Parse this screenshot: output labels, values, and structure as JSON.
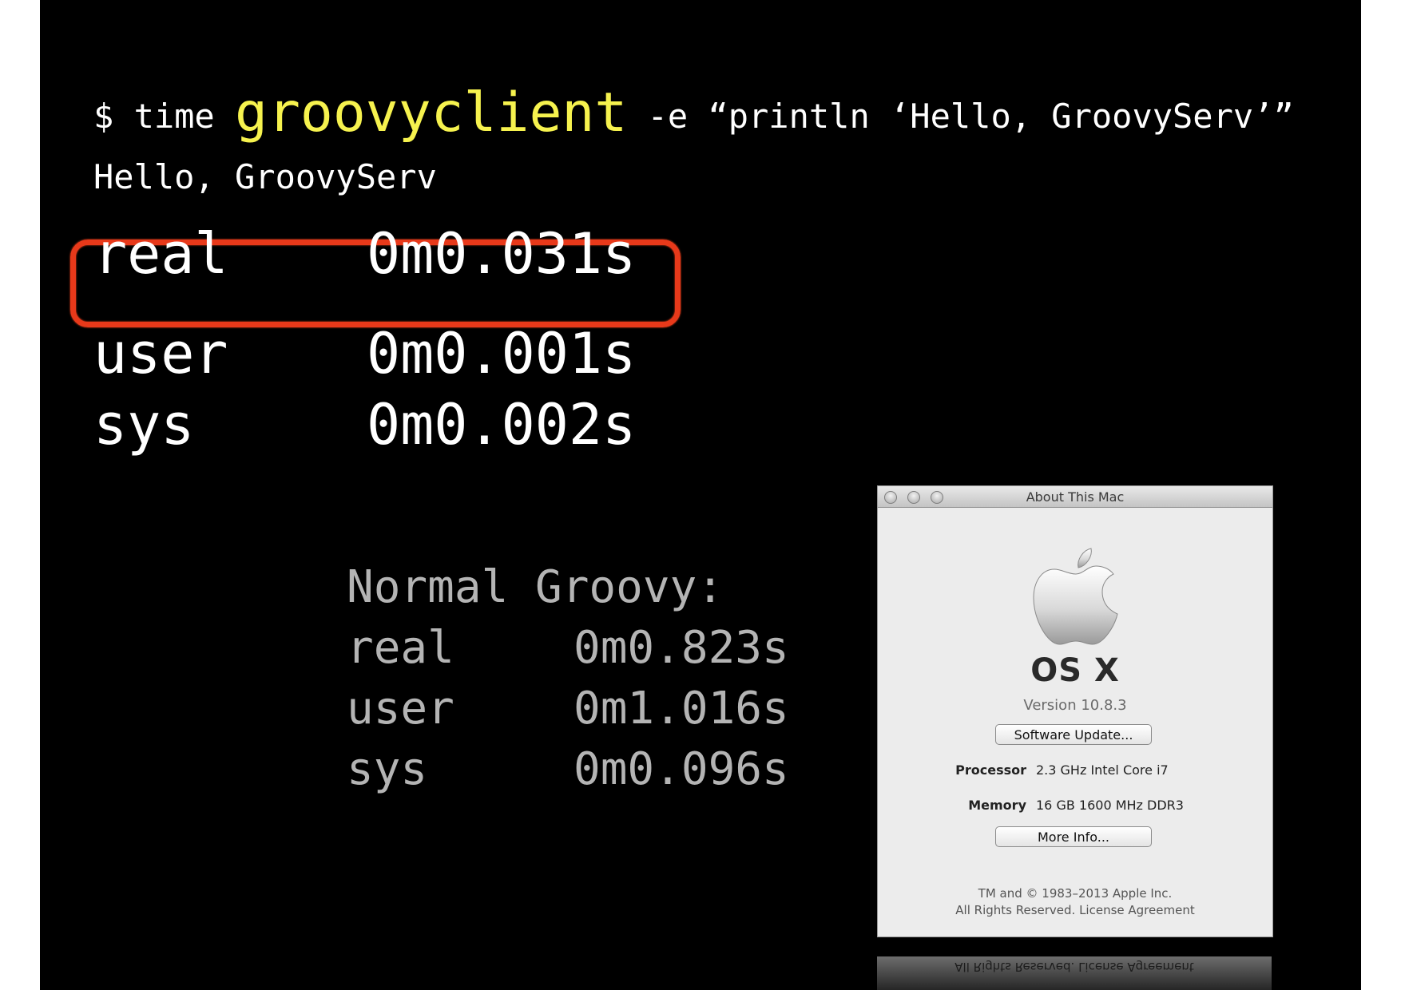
{
  "terminal": {
    "prompt": "$ time ",
    "command": "groovyclient",
    "args": " -e “println ‘Hello, GroovyServ’”",
    "output": "Hello, GroovyServ"
  },
  "groovyserv_timing": [
    {
      "label": "real",
      "value": "0m0.031s"
    },
    {
      "label": "user",
      "value": "0m0.001s"
    },
    {
      "label": "sys",
      "value": "0m0.002s"
    }
  ],
  "normal_groovy": {
    "heading": "Normal Groovy:",
    "rows": [
      {
        "label": "real",
        "value": "0m0.823s"
      },
      {
        "label": "user",
        "value": "0m1.016s"
      },
      {
        "label": "sys",
        "value": "0m0.096s"
      }
    ]
  },
  "about_mac": {
    "title": "About This Mac",
    "os_name": "OS X",
    "version": "Version 10.8.3",
    "software_update_label": "Software Update...",
    "processor_label": "Processor",
    "processor_value": "2.3 GHz Intel Core i7",
    "memory_label": "Memory",
    "memory_value": "16 GB 1600 MHz DDR3",
    "more_info_label": "More Info...",
    "copyright_line1": "TM and © 1983–2013 Apple Inc.",
    "copyright_line2": "All Rights Reserved.  License Agreement",
    "reflection_text": "All Rights Reserved.  License Agreement"
  },
  "colors": {
    "background": "#000000",
    "command_highlight": "#f6f24e",
    "circle_mark": "#e8391a",
    "normal_text": "#b4b4b4"
  }
}
